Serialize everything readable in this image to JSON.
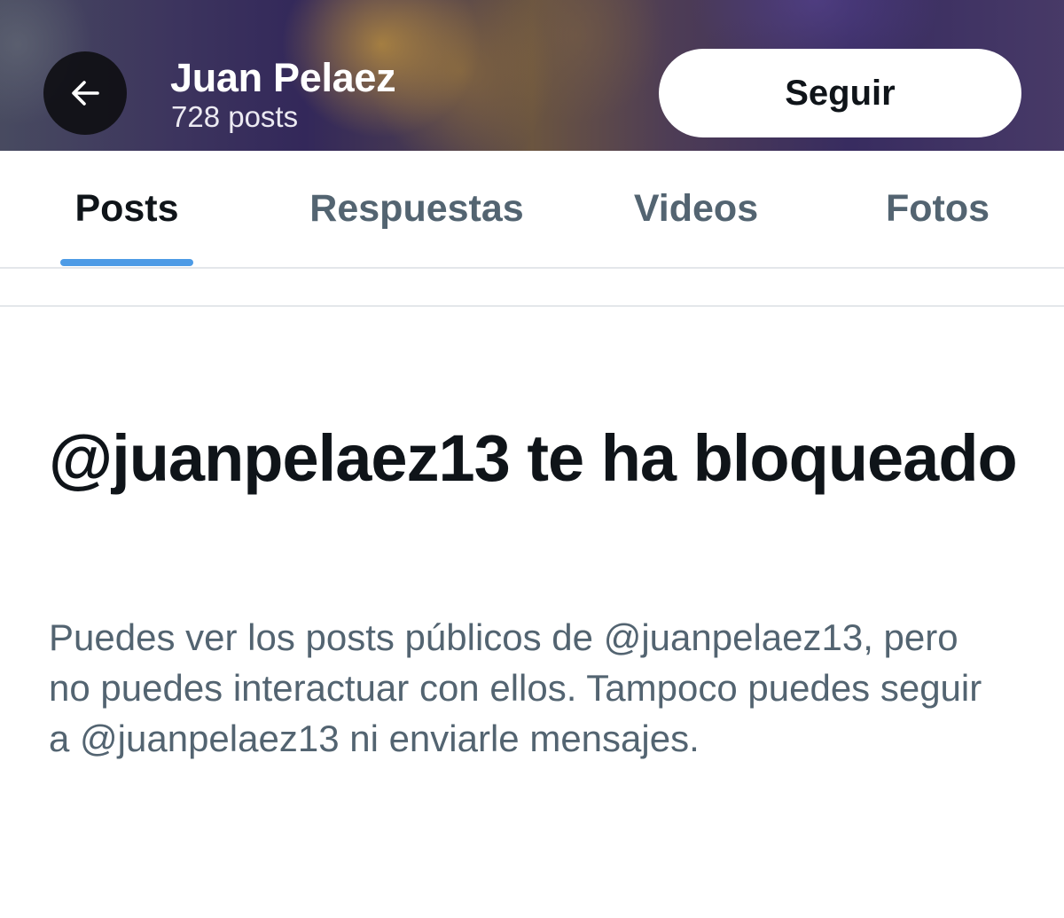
{
  "header": {
    "back_icon": "arrow-left-icon",
    "profile_name": "Juan Pelaez",
    "post_count": "728 posts",
    "follow_label": "Seguir"
  },
  "tabs": [
    {
      "label": "Posts",
      "active": true
    },
    {
      "label": "Respuestas",
      "active": false
    },
    {
      "label": "Videos",
      "active": false
    },
    {
      "label": "Fotos",
      "active": false
    }
  ],
  "blocked": {
    "title": "@juanpelaez13 te ha bloqueado",
    "description": "Puedes ver los posts públicos de @juanpelaez13, pero no puedes interactuar con ellos. Tampoco puedes seguir a @juanpelaez13 ni enviarle mensajes."
  },
  "colors": {
    "accent": "#1d9bf0",
    "tab_indicator": "#4d9be6",
    "text_primary": "#0f1419",
    "text_secondary": "#536471"
  }
}
